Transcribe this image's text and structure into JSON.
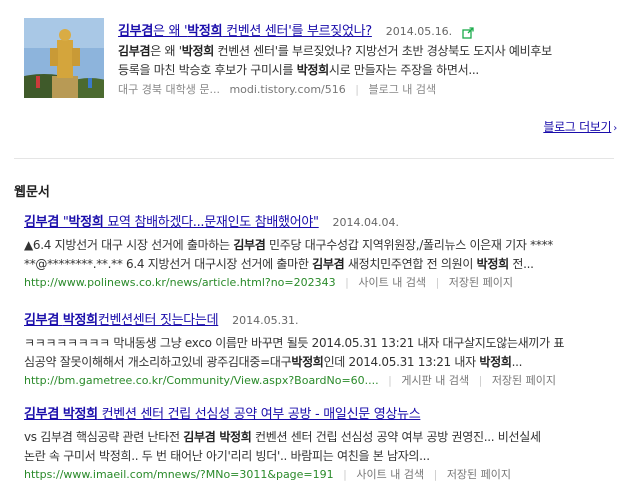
{
  "blog": {
    "title_pre": "김부겸",
    "title_mid1": "은 왜 '",
    "title_bold2": "박정희",
    "title_post": " 컨벤션 센터'를 부르짖었나?",
    "date": "2014.05.16.",
    "desc_line1_b1": "김부겸",
    "desc_line1_t1": "은 왜 '",
    "desc_line1_b2": "박정희",
    "desc_line1_t2": " 컨벤션 센터'를 부르짖었나? 지방선거 초반 경상북도 도지사 예비후보",
    "desc_line2_t1": "등록을 마친 박승호 후보가 구미시를 ",
    "desc_line2_b1": "박정희",
    "desc_line2_t2": "시로 만들자는 주장을 하면서...",
    "source": "대구 경북 대학생 문...",
    "url": "modi.tistory.com/516",
    "action": "블로그 내 검색"
  },
  "more_link": "블로그 더보기",
  "section_title": "웹문서",
  "web": [
    {
      "title_b1": "김부겸",
      "title_t1": " \"",
      "title_b2": "박정희",
      "title_t2": " 묘역 참배하겠다...문재인도 참배했어야\"",
      "date": "2014.04.04.",
      "d1_t1": "▲6.4 지방선거 대구 시장 선거에 출마하는 ",
      "d1_b1": "김부겸",
      "d1_t2": " 민주당 대구수성갑 지역위원장,/폴리뉴스 이은재 기자 ****",
      "d2_t1": "**@********.**.** 6.4 지방선거 대구시장 선거에 출마한 ",
      "d2_b1": "김부겸",
      "d2_t2": " 새정치민주연합 전 의원이 ",
      "d2_b2": "박정희",
      "d2_t3": " 전...",
      "url": "http://www.polinews.co.kr/news/article.html?no=202343",
      "act1": "사이트 내 검색",
      "act2": "저장된 페이지"
    },
    {
      "title_b1": "김부겸",
      "title_t1": " ",
      "title_b2": "박정희",
      "title_t2": "컨벤션센터 짓는다는데",
      "date": "2014.05.31.",
      "d1_t1": "ㅋㅋㅋㅋㅋㅋㅋㅋ 막내동생 그냥 exco 이름만 바꾸면 될듯 2014.05.31 13:21 내자 대구살지도않는새끼가 표",
      "d2_t1": "심공약 잘못이해해서 개소리하고있네 광주김대중=대구",
      "d2_b1": "박정희",
      "d2_t2": "인데 2014.05.31 13:21 내자 ",
      "d2_b2": "박정희",
      "d2_t3": "...",
      "url": "http://bm.gametree.co.kr/Community/View.aspx?BoardNo=60....",
      "act1": "게시판 내 검색",
      "act2": "저장된 페이지"
    },
    {
      "title_b1": "김부겸",
      "title_t1": " ",
      "title_b2": "박정희",
      "title_t2": " 컨벤션 센터 건립 선심성 공약 여부 공방 - 매일신문 영상뉴스",
      "d1_t1": "vs 김부겸 핵심공략 관련 난타전 ",
      "d1_b1": "김부겸 박정희",
      "d1_t2": " 컨벤션 센터 건립 선심성 공약 여부 공방 권영진... 비선실세",
      "d2_t1": "논란 속 구미서 박정희.. 두 번 태어난 아기'리리 빙더'.. 바람피는 여친을 본 남자의...",
      "url": "https://www.imaeil.com/mnews/?MNo=3011&page=191",
      "act1": "사이트 내 검색",
      "act2": "저장된 페이지"
    }
  ],
  "colors": {
    "link": "#1a0dab",
    "url_green": "#2a8a2a",
    "share_green": "#1aab4a"
  },
  "icons": {
    "share": "share-external-icon",
    "more_arrow": "chevron-right-icon"
  }
}
